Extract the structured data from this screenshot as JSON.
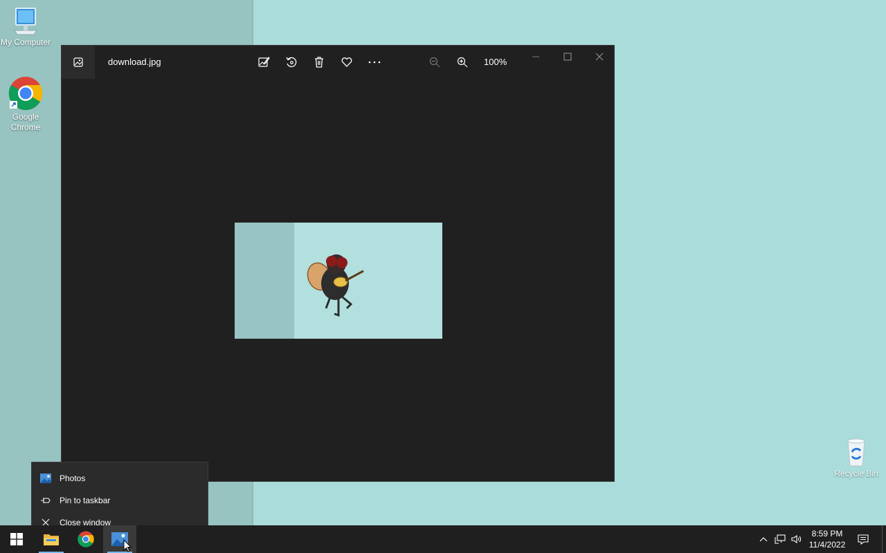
{
  "desktop": {
    "icons": [
      {
        "label": "My Computer",
        "icon": "computer-icon"
      },
      {
        "label": "Google Chrome",
        "icon": "chrome-icon"
      },
      {
        "label": "Recycle Bin",
        "icon": "recycle-bin-icon"
      }
    ]
  },
  "window": {
    "title": "download.jpg",
    "app_icon": "photos-icon",
    "toolbar": [
      {
        "name": "edit-image",
        "icon": "edit-image-icon"
      },
      {
        "name": "rotate",
        "icon": "rotate-icon"
      },
      {
        "name": "delete",
        "icon": "trash-icon"
      },
      {
        "name": "favorite",
        "icon": "heart-icon"
      },
      {
        "name": "more",
        "icon": "more-icon"
      }
    ],
    "zoom_out_icon": "zoom-out-icon",
    "zoom_in_icon": "zoom-in-icon",
    "zoom_level": "100%",
    "controls": [
      "minimize-icon",
      "maximize-icon",
      "close-icon"
    ],
    "image_subject": "fly playing guitar"
  },
  "jumplist": {
    "items": [
      {
        "label": "Photos",
        "icon": "photos-icon"
      },
      {
        "label": "Pin to taskbar",
        "icon": "pin-icon"
      },
      {
        "label": "Close window",
        "icon": "close-icon"
      }
    ]
  },
  "taskbar": {
    "apps": [
      "start-icon",
      "file-explorer-icon",
      "chrome-icon",
      "photos-icon"
    ],
    "active_app": "photos-icon",
    "tray": [
      "chevron-up-icon",
      "network-icon",
      "volume-icon"
    ],
    "time": "8:59 PM",
    "date": "11/4/2022",
    "notification_icon": "notification-icon"
  },
  "colors": {
    "wallpaper": "#a9dcda",
    "window_bg": "#202020",
    "taskbar_bg": "#1f1f1f",
    "accent": "#76b9ed"
  }
}
